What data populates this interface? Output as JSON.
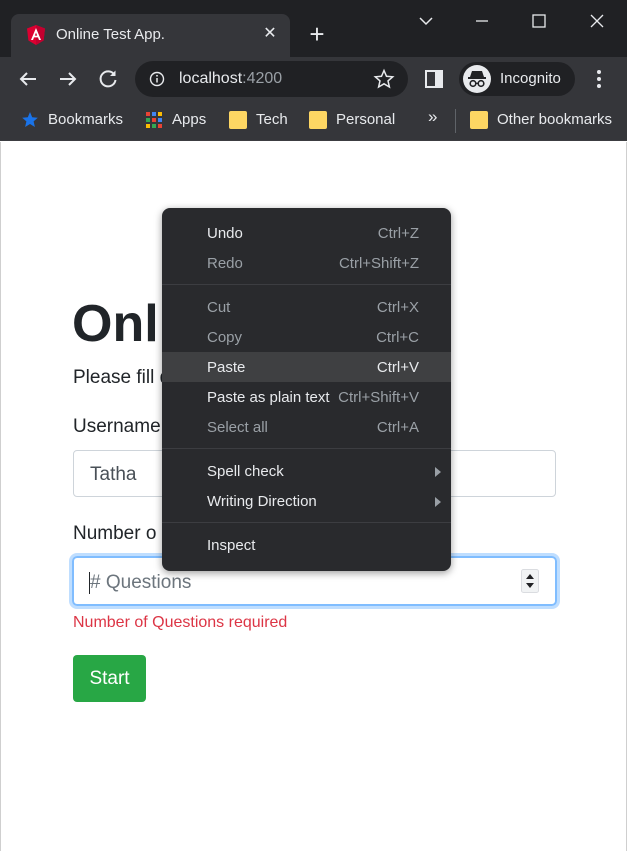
{
  "tab": {
    "title": "Online Test App.",
    "close": "✕"
  },
  "new_tab_symbol": "+",
  "address": {
    "host": "localhost",
    "port": ":4200"
  },
  "profile": {
    "label": "Incognito"
  },
  "bookmarks": {
    "items": [
      {
        "label": "Bookmarks",
        "icon": "star-icon"
      },
      {
        "label": "Apps",
        "icon": "apps-grid-icon"
      },
      {
        "label": "Tech",
        "icon": "folder-icon"
      },
      {
        "label": "Personal",
        "icon": "folder-icon"
      }
    ],
    "more": "»",
    "other": "Other bookmarks"
  },
  "page": {
    "heading": "Onli",
    "lead": "Please fill d",
    "username_label": "Username",
    "username_value": "Tatha",
    "questions_label": "Number o",
    "questions_placeholder": "# Questions",
    "error": "Number of Questions required",
    "start_label": "Start"
  },
  "context_menu": {
    "items": [
      {
        "label": "Undo",
        "shortcut": "Ctrl+Z"
      },
      {
        "label": "Redo",
        "shortcut": "Ctrl+Shift+Z"
      },
      {
        "label": "Cut",
        "shortcut": "Ctrl+X"
      },
      {
        "label": "Copy",
        "shortcut": "Ctrl+C"
      },
      {
        "label": "Paste",
        "shortcut": "Ctrl+V"
      },
      {
        "label": "Paste as plain text",
        "shortcut": "Ctrl+Shift+V"
      },
      {
        "label": "Select all",
        "shortcut": "Ctrl+A"
      },
      {
        "label": "Spell check"
      },
      {
        "label": "Writing Direction"
      },
      {
        "label": "Inspect"
      }
    ]
  },
  "colors": {
    "chrome_dark": "#202124",
    "chrome_toolbar": "#35363a",
    "accent_success": "#28a745",
    "error": "#dc3545",
    "angular_red": "#dd0031"
  }
}
